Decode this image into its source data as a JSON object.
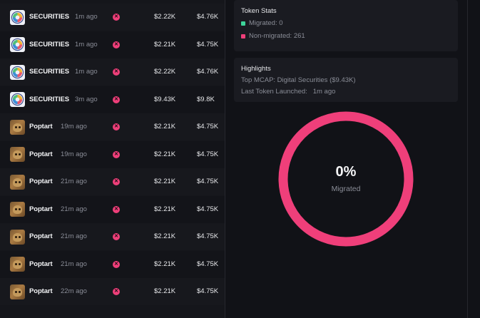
{
  "token_list": [
    {
      "name": "SECURITIES",
      "age": "1m ago",
      "mcap": "$2.22K",
      "volume": "$4.76K",
      "avatar": "securities-logo"
    },
    {
      "name": "SECURITIES",
      "age": "1m ago",
      "mcap": "$2.21K",
      "volume": "$4.75K",
      "avatar": "securities-logo"
    },
    {
      "name": "SECURITIES",
      "age": "1m ago",
      "mcap": "$2.22K",
      "volume": "$4.76K",
      "avatar": "securities-logo"
    },
    {
      "name": "SECURITIES",
      "age": "3m ago",
      "mcap": "$9.43K",
      "volume": "$9.8K",
      "avatar": "securities-logo"
    },
    {
      "name": "Poptart",
      "age": "19m ago",
      "mcap": "$2.21K",
      "volume": "$4.75K",
      "avatar": "cat-avatar"
    },
    {
      "name": "Poptart",
      "age": "19m ago",
      "mcap": "$2.21K",
      "volume": "$4.75K",
      "avatar": "cat-avatar"
    },
    {
      "name": "Poptart",
      "age": "21m ago",
      "mcap": "$2.21K",
      "volume": "$4.75K",
      "avatar": "cat-avatar"
    },
    {
      "name": "Poptart",
      "age": "21m ago",
      "mcap": "$2.21K",
      "volume": "$4.75K",
      "avatar": "cat-avatar"
    },
    {
      "name": "Poptart",
      "age": "21m ago",
      "mcap": "$2.21K",
      "volume": "$4.75K",
      "avatar": "cat-avatar"
    },
    {
      "name": "Poptart",
      "age": "21m ago",
      "mcap": "$2.21K",
      "volume": "$4.75K",
      "avatar": "cat-avatar"
    },
    {
      "name": "Poptart",
      "age": "22m ago",
      "mcap": "$2.21K",
      "volume": "$4.75K",
      "avatar": "cat-avatar"
    }
  ],
  "status_icon": "close-circle-icon",
  "token_stats": {
    "title": "Token Stats",
    "migrated": "Migrated: 0",
    "non_migrated": "Non-migrated: 261",
    "migrated_color": "#3ed49a",
    "non_migrated_color": "#ef3f7a"
  },
  "highlights": {
    "title": "Highlights",
    "top_mcap": "Top MCAP: Digital Securities ($9.43K)",
    "last_launched": "Last Token Launched:   1m ago"
  },
  "migration_chart": {
    "percent_label": "0%",
    "caption": "Migrated",
    "migrated_fraction": 0,
    "ring_color": "#ef3f7a"
  }
}
